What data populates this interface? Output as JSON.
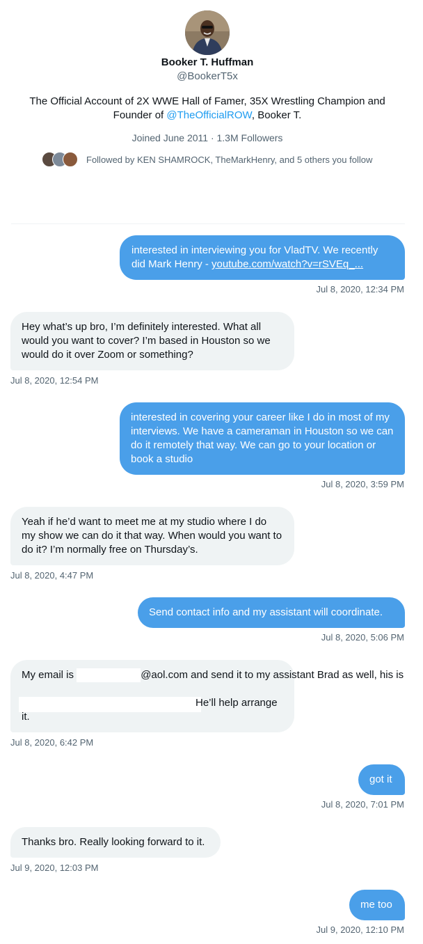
{
  "profile": {
    "name": "Booker T. Huffman",
    "handle": "@BookerT5x",
    "bio_prefix": "The Official Account of 2X WWE Hall of Famer, 35X Wrestling Champion and Founder of ",
    "bio_mention": "@TheOfficialROW",
    "bio_suffix": ", Booker T.",
    "joined": "Joined June 2011 · 1.3M Followers",
    "followed_by": "Followed by KEN SHAMROCK, TheMarkHenry, and 5 others you follow"
  },
  "messages": [
    {
      "direction": "sent",
      "text_before_link": "interested in interviewing you for VladTV.  We recently did Mark Henry - ",
      "link": "youtube.com/watch?v=rSVEq_...",
      "time": "Jul 8, 2020, 12:34 PM"
    },
    {
      "direction": "received",
      "text": "Hey what’s up bro, I’m definitely interested. What all would you want to cover? I’m based in Houston so we would do it over Zoom or something?",
      "time": "Jul 8, 2020, 12:54 PM"
    },
    {
      "direction": "sent",
      "text": "interested in covering your career like I do in most of my interviews.  We have a cameraman in Houston so we can do it remotely that way.  We can go to your location or book a studio",
      "time": "Jul 8, 2020, 3:59 PM"
    },
    {
      "direction": "received",
      "text": "Yeah if he’d want to meet me at my studio where I do my show we can do it that way. When would you want to do it? I’m normally free on Thursday’s.",
      "time": "Jul 8, 2020, 4:47 PM"
    },
    {
      "direction": "sent",
      "text": "Send contact info and my assistant will coordinate.",
      "time": "Jul 8, 2020, 5:06 PM"
    },
    {
      "direction": "received",
      "text_part1": "My email is ",
      "text_part2": "@aol.com and send it to my assistant Brad as well, his is",
      "text_part3": "He’ll help arrange",
      "text_part4": "it.",
      "time": "Jul 8, 2020, 6:42 PM"
    },
    {
      "direction": "sent",
      "text": "got it",
      "time": "Jul 8, 2020, 7:01 PM"
    },
    {
      "direction": "received",
      "text": "Thanks bro. Really looking forward to it.",
      "time": "Jul 9, 2020, 12:03 PM"
    },
    {
      "direction": "sent",
      "text": "me too",
      "time": "Jul 9, 2020, 12:10 PM"
    }
  ],
  "colors": {
    "sent_bubble": "#4a9fe9",
    "received_bubble": "#eff3f4",
    "mention": "#1d9bf0",
    "secondary_text": "#536471"
  },
  "icons": [
    "avatar",
    "mini-avatar"
  ]
}
